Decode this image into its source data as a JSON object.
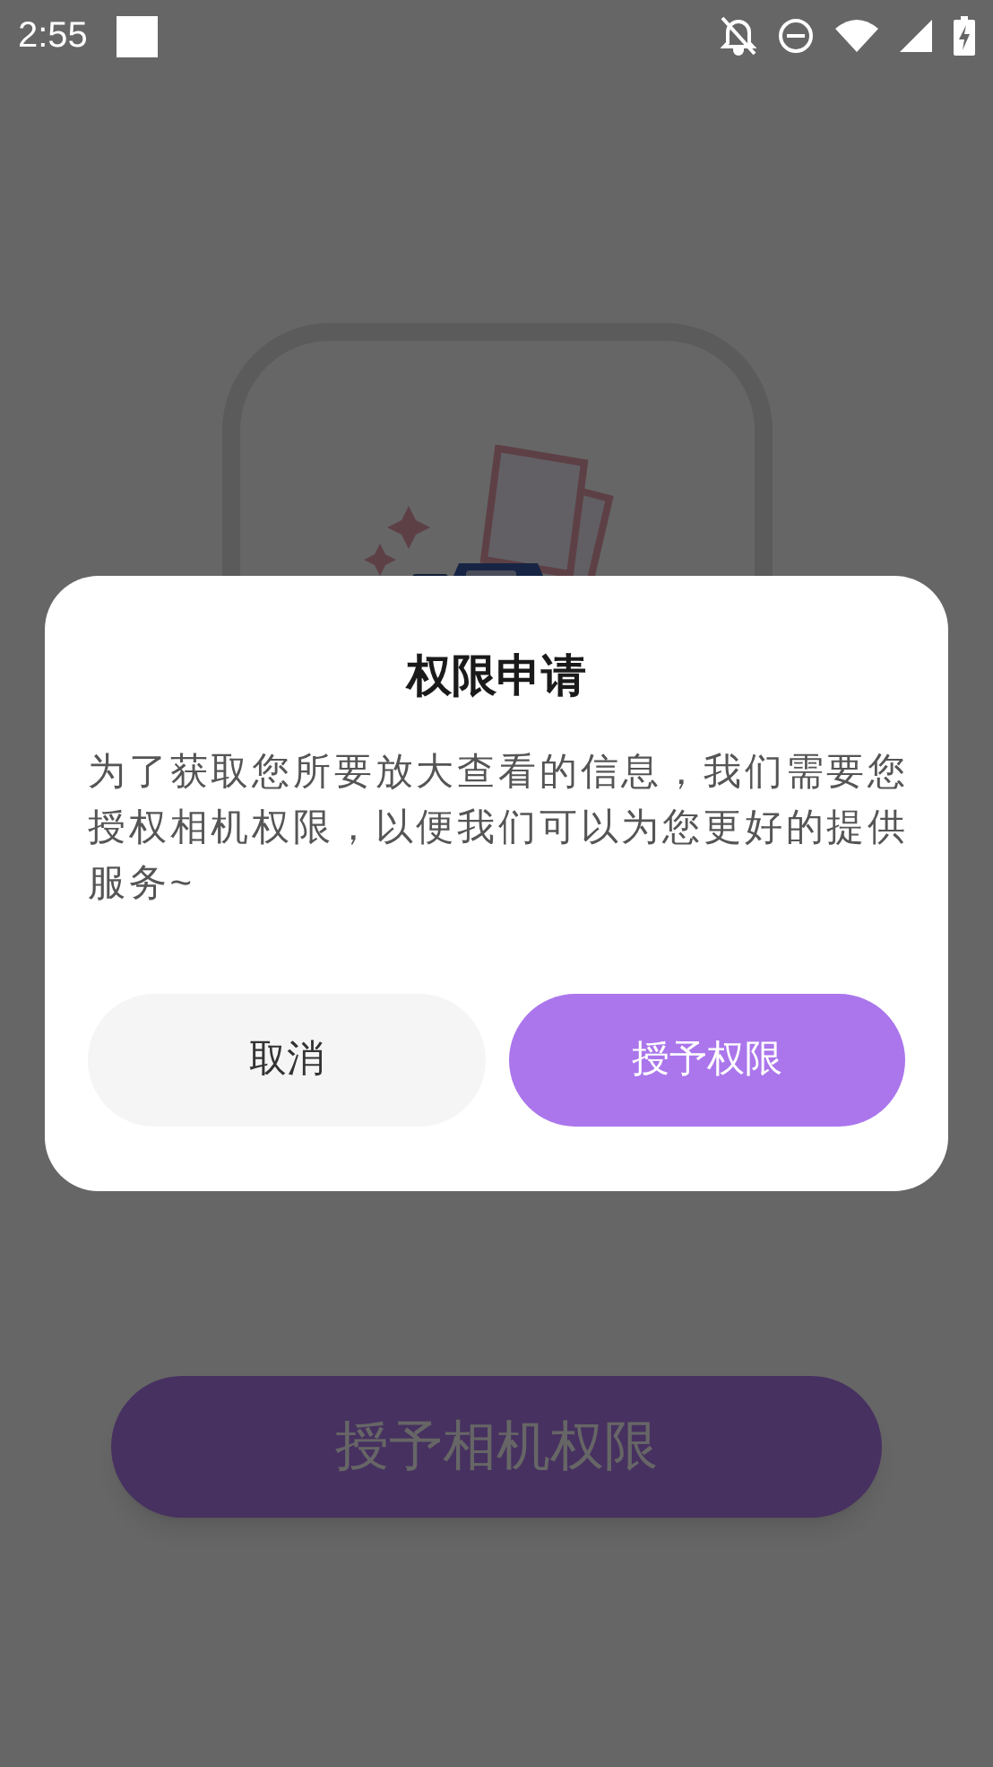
{
  "status_bar": {
    "time": "2:55"
  },
  "page": {
    "button_label": "授予相机权限"
  },
  "dialog": {
    "title": "权限申请",
    "message": "为了获取您所要放大查看的信息，我们需要您授权相机权限，以便我们可以为您更好的提供服务~",
    "buttons": [
      {
        "label": "取消",
        "kind": "secondary"
      },
      {
        "label": "授予权限",
        "kind": "primary"
      }
    ]
  }
}
